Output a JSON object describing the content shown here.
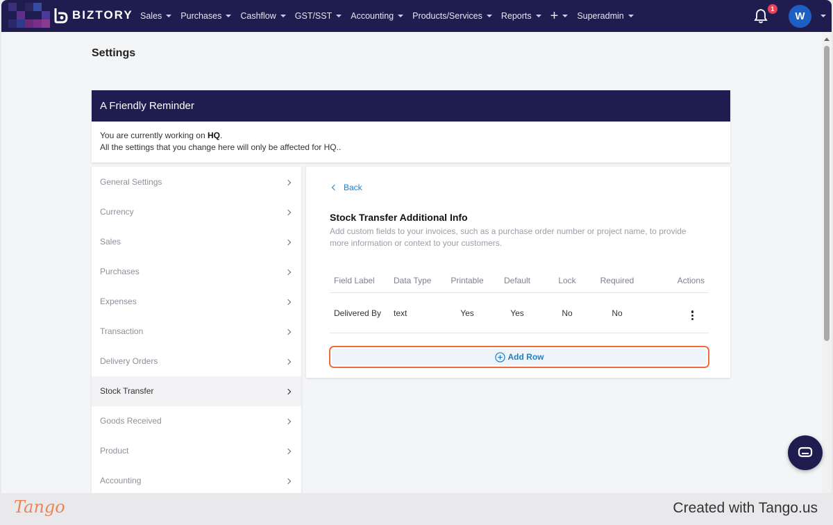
{
  "nav": {
    "brand": "BIZTORY",
    "menu": [
      {
        "label": "Sales"
      },
      {
        "label": "Purchases"
      },
      {
        "label": "Cashflow"
      },
      {
        "label": "GST/SST"
      },
      {
        "label": "Accounting"
      },
      {
        "label": "Products/Services"
      },
      {
        "label": "Reports"
      },
      {
        "label": "+"
      },
      {
        "label": "Superadmin"
      }
    ],
    "notification_count": "1",
    "avatar_initial": "W"
  },
  "page": {
    "title": "Settings"
  },
  "reminder": {
    "title": "A Friendly Reminder",
    "line1_prefix": "You are currently working on ",
    "line1_bold": "HQ",
    "line1_suffix": ".",
    "line2": "All the settings that you change here will only be affected for HQ.."
  },
  "sidebar": {
    "items": [
      {
        "label": "General Settings"
      },
      {
        "label": "Currency"
      },
      {
        "label": "Sales"
      },
      {
        "label": "Purchases"
      },
      {
        "label": "Expenses"
      },
      {
        "label": "Transaction"
      },
      {
        "label": "Delivery Orders"
      },
      {
        "label": "Stock Transfer"
      },
      {
        "label": "Goods Received"
      },
      {
        "label": "Product"
      },
      {
        "label": "Accounting"
      }
    ],
    "active": "Stock Transfer"
  },
  "content": {
    "back_label": "Back",
    "title": "Stock Transfer Additional Info",
    "description": "Add custom fields to your invoices, such as a purchase order number or project name, to provide more information or context to your customers.",
    "table": {
      "headers": [
        "Field Label",
        "Data Type",
        "Printable",
        "Default",
        "Lock",
        "Required",
        "Actions"
      ],
      "rows": [
        [
          "Delivered By",
          "text",
          "Yes",
          "Yes",
          "No",
          "No"
        ]
      ]
    },
    "add_row_label": "Add Row"
  },
  "footer": {
    "logo_text": "Tango",
    "created_text": "Created with Tango.us"
  },
  "colors": {
    "nav_bg": "#1f1c4f",
    "accent_blue": "#1f7fc4",
    "highlight_orange": "#ef6a3a",
    "badge_red": "#e8425a"
  }
}
